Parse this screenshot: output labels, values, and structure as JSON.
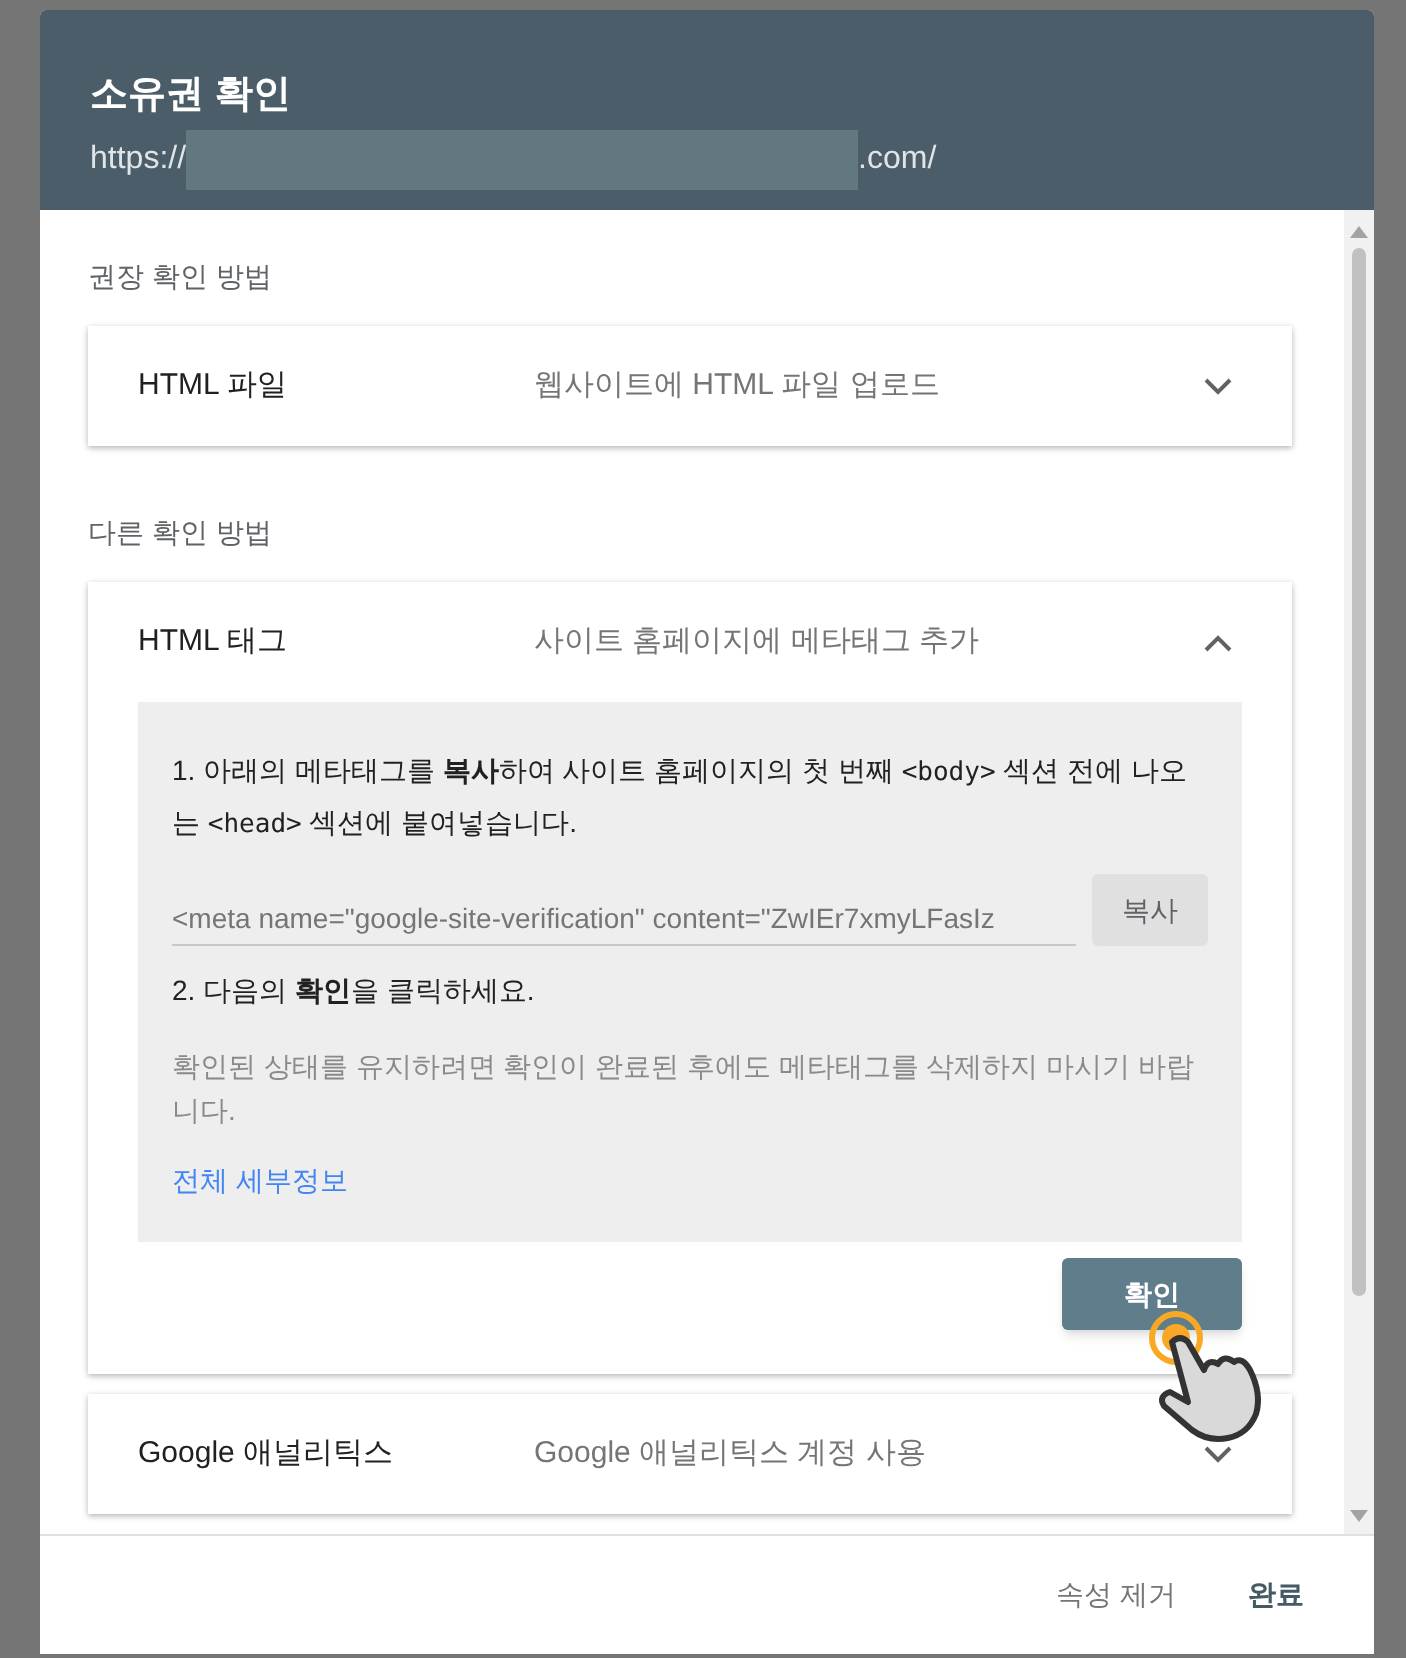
{
  "dialog": {
    "title": "소유권 확인",
    "url_prefix": "https://",
    "url_suffix": ".com/"
  },
  "sections": [
    {
      "heading": "권장 확인 방법",
      "methods": [
        {
          "name": "HTML 파일",
          "description": "웹사이트에 HTML 파일 업로드",
          "expanded": false
        }
      ]
    },
    {
      "heading": "다른 확인 방법",
      "methods": [
        {
          "name": "HTML 태그",
          "description": "사이트 홈페이지에 메타태그 추가",
          "expanded": true,
          "details": {
            "step1": [
              {
                "kind": "text",
                "text": "1. 아래의 메타태그를 **복사**하여 사이트 홈페이지의 첫 번째 "
              },
              {
                "kind": "code",
                "text": "<body>"
              },
              {
                "kind": "text",
                "text": " 섹션 전에 나오는 "
              },
              {
                "kind": "code",
                "text": "<head>"
              },
              {
                "kind": "text",
                "text": " 섹션에 붙여넣습니다."
              }
            ],
            "meta_tag": "<meta name=\"google-site-verification\" content=\"ZwIEr7xmyLFasIz",
            "copy_button": "복사",
            "step2": "2. 다음의 **확인**을 클릭하세요.",
            "note": "확인된 상태를 유지하려면 확인이 완료된 후에도 메타태그를 삭제하지 마시기 바랍니다.",
            "link": "전체 세부정보",
            "verify_button": "확인"
          }
        },
        {
          "name": "Google 애널리틱스",
          "description": "Google 애널리틱스 계정 사용",
          "expanded": false
        }
      ]
    }
  ],
  "footer": {
    "buttons": [
      "속성 제거",
      "완료"
    ]
  }
}
